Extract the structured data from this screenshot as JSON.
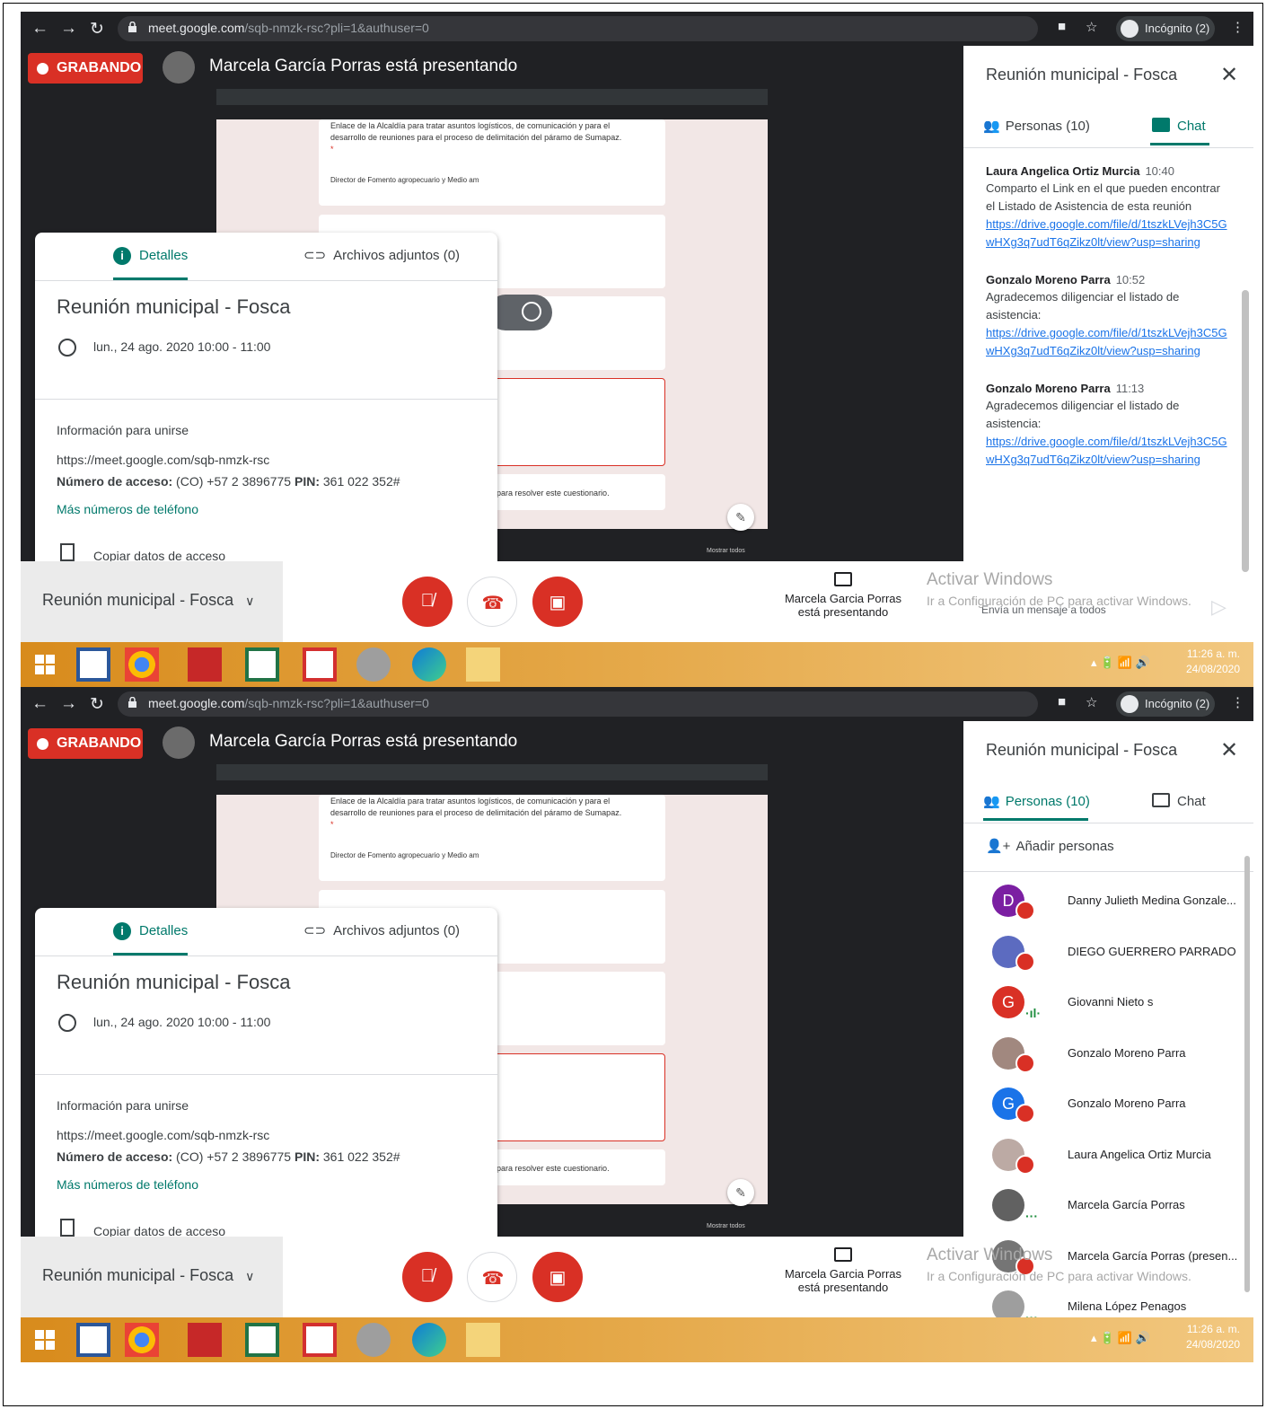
{
  "browser": {
    "url_host": "meet.google.com",
    "url_path": "/sqb-nmzk-rsc?pli=1&authuser=0",
    "incognito_label": "Incógnito (2)"
  },
  "meet": {
    "recording_label": "GRABANDO",
    "presenting_title": "Marcela García Porras está presentando",
    "shared_doc": {
      "line1": "Enlace de la Alcaldía para tratar asuntos logísticos, de comunicación y para el",
      "line2": "desarrollo de reuniones para el proceso de delimitación del páramo de Sumapaz.",
      "asterisk": "*",
      "director": "Director de Fomento agropecuario y Medio am",
      "resolve": "para resolver este cuestionario.",
      "show_all": "Mostrar todos"
    },
    "details": {
      "tab_details": "Detalles",
      "tab_attachments": "Archivos adjuntos (0)",
      "title": "Reunión municipal - Fosca",
      "datetime": "lun., 24 ago. 2020 10:00 - 11:00",
      "join_heading": "Información para unirse",
      "join_url": "https://meet.google.com/sqb-nmzk-rsc",
      "access_label": "Número de acceso:",
      "access_value": " (CO) +57 2 3896775 ",
      "pin_label": "PIN:",
      "pin_value": " 361 022 352#",
      "more_numbers": "Más números de teléfono",
      "copy_access": "Copiar datos de acceso"
    },
    "bottom": {
      "meeting_title": "Reunión municipal - Fosca",
      "presenting_line1": "Marcela Garcia Porras",
      "presenting_line2": "está presentando"
    },
    "watermark": {
      "line1": "Activar Windows",
      "line2": "Ir a Configuración de PC para activar Windows."
    },
    "panel": {
      "title": "Reunión municipal - Fosca",
      "tab_people": "Personas (10)",
      "tab_chat": "Chat",
      "send_placeholder": "Envía un mensaje a todos",
      "add_people": "Añadir personas"
    },
    "chat": [
      {
        "author": "Laura Angelica Ortiz Murcia",
        "time": "10:40",
        "text": "Comparto el Link en el que pueden encontrar el Listado de Asistencia de esta reunión",
        "link": "https://drive.google.com/file/d/1tszkLVejh3C5GwHXg3q7udT6qZikz0lt/view?usp=sharing"
      },
      {
        "author": "Gonzalo Moreno Parra",
        "time": "10:52",
        "text": "Agradecemos diligenciar el listado de asistencia:",
        "link": "https://drive.google.com/file/d/1tszkLVejh3C5GwHXg3q7udT6qZikz0lt/view?usp=sharing"
      },
      {
        "author": "Gonzalo Moreno Parra",
        "time": "11:13",
        "text": "Agradecemos diligenciar el listado de asistencia:",
        "link": "https://drive.google.com/file/d/1tszkLVejh3C5GwHXg3q7udT6qZikz0lt/view?usp=sharing"
      }
    ],
    "participants": [
      {
        "name": "Danny Julieth Medina Gonzale...",
        "initial": "D",
        "color": "#7b1fa2",
        "status": "muted"
      },
      {
        "name": "DIEGO GUERRERO PARRADO",
        "initial": "",
        "color": "#5c6bc0",
        "status": "muted"
      },
      {
        "name": "Giovanni Nieto s",
        "initial": "G",
        "color": "#d93025",
        "status": "speaking"
      },
      {
        "name": "Gonzalo Moreno Parra",
        "initial": "",
        "color": "#a1887f",
        "status": "muted"
      },
      {
        "name": "Gonzalo Moreno Parra",
        "initial": "G",
        "color": "#1a73e8",
        "status": "muted"
      },
      {
        "name": "Laura Angelica Ortiz Murcia",
        "initial": "",
        "color": "#bcaaa4",
        "status": "muted"
      },
      {
        "name": "Marcela García Porras",
        "initial": "",
        "color": "#616161",
        "status": "active"
      },
      {
        "name": "Marcela García Porras (presen...",
        "initial": "",
        "color": "#757575",
        "status": "muted"
      },
      {
        "name": "Milena López Penagos",
        "initial": "",
        "color": "#9e9e9e",
        "status": "active"
      }
    ]
  },
  "taskbar": {
    "time": "11:26 a. m.",
    "date": "24/08/2020"
  },
  "colors": {
    "accent": "#00796b",
    "danger": "#d93025",
    "link": "#1a73e8"
  }
}
